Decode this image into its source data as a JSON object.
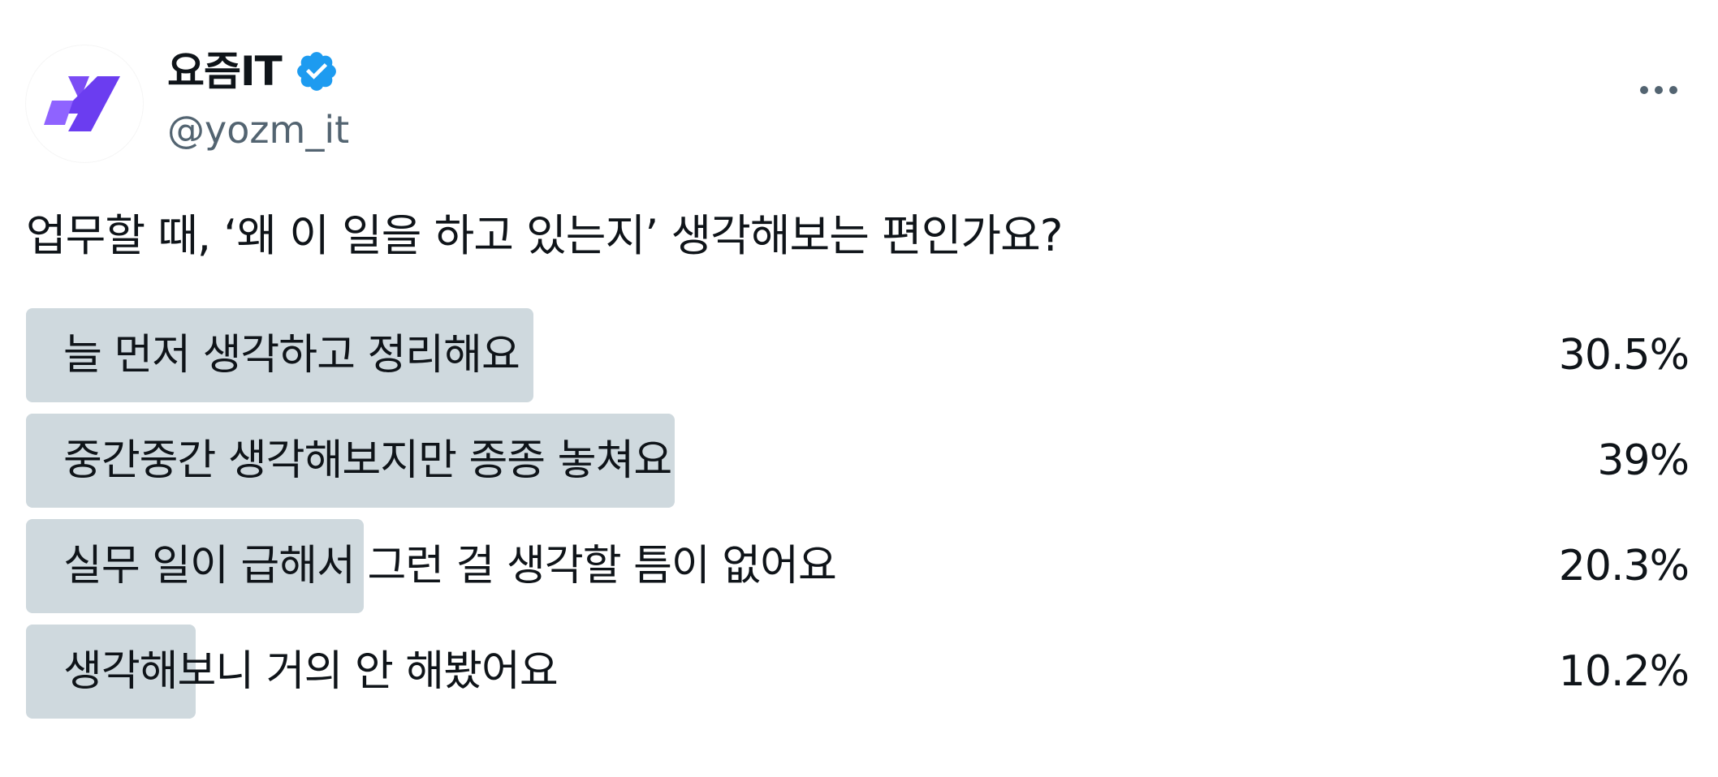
{
  "author": {
    "display_name": "요즘IT",
    "handle": "@yozm_it",
    "verified": true,
    "avatar_icon": "yozm-logo-icon",
    "brand_color": "#6b3df0"
  },
  "menu": {
    "icon": "more-options-icon"
  },
  "post": {
    "question": "업무할 때, ‘왜 이 일을 하고 있는지’ 생각해보는 편인가요?"
  },
  "poll": {
    "options": [
      {
        "label": "늘 먼저 생각하고 정리해요",
        "percent": "30.5%",
        "value": 30.5
      },
      {
        "label": "중간중간 생각해보지만 종종 놓쳐요",
        "percent": "39%",
        "value": 39
      },
      {
        "label": "실무 일이 급해서 그런 걸 생각할 틈이 없어요",
        "percent": "20.3%",
        "value": 20.3
      },
      {
        "label": "생각해보니 거의 안 해봤어요",
        "percent": "10.2%",
        "value": 10.2
      }
    ],
    "bar_color": "#cfd9de"
  },
  "colors": {
    "text_primary": "#0f1419",
    "text_secondary": "#536471",
    "verified_badge": "#1d9bf0"
  }
}
